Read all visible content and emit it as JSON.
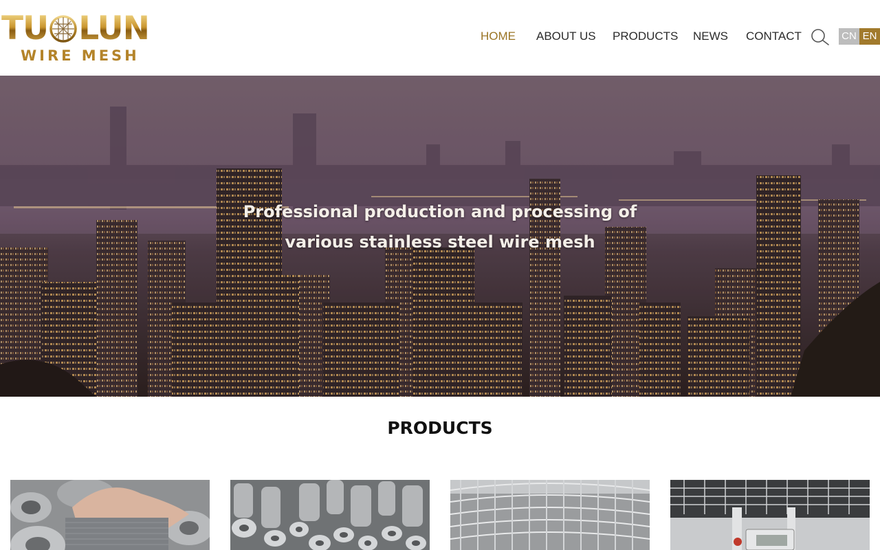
{
  "brand": {
    "logo_top": "TUOLUN",
    "logo_top_left": "TU",
    "logo_top_right": "LUN",
    "logo_bottom": "WIRE MESH"
  },
  "nav": {
    "items": [
      {
        "label": "HOME",
        "active": true
      },
      {
        "label": "ABOUT US",
        "active": false
      },
      {
        "label": "PRODUCTS",
        "active": false
      },
      {
        "label": "NEWS",
        "active": false
      },
      {
        "label": "CONTACT",
        "active": false
      }
    ],
    "search_icon": "search-icon",
    "languages": [
      {
        "label": "CN",
        "active": false
      },
      {
        "label": "EN",
        "active": true
      }
    ]
  },
  "hero": {
    "line1": "Professional production and processing of",
    "line2": "various stainless steel wire mesh",
    "image": "night city skyline"
  },
  "products": {
    "title": "PRODUCTS",
    "items": [
      {
        "image": "stainless steel wire mesh rolls with hand"
      },
      {
        "image": "stacked wire mesh rolls"
      },
      {
        "image": "welded wire mesh roll"
      },
      {
        "image": "wire mesh measurement with caliper"
      }
    ]
  },
  "colors": {
    "accent_gold": "#9a7424",
    "lang_active": "#a17a2c",
    "lang_inactive": "#bdbdbd",
    "nav_text": "#2b2b2b"
  }
}
